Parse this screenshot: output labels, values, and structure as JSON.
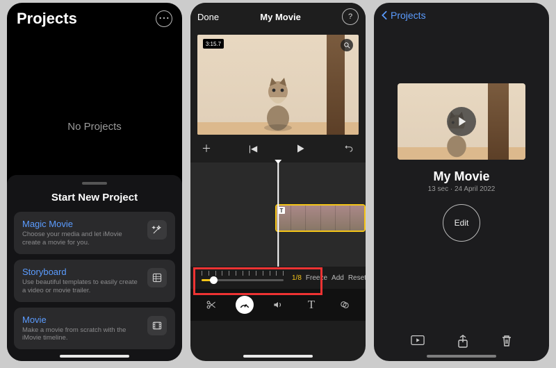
{
  "left": {
    "title": "Projects",
    "no_projects": "No Projects",
    "sheet_title": "Start New Project",
    "options": [
      {
        "title": "Magic Movie",
        "subtitle": "Choose your media and let iMovie create a movie for you.",
        "icon": "magic-wand"
      },
      {
        "title": "Storyboard",
        "subtitle": "Use beautiful templates to easily create a video or movie trailer.",
        "icon": "storyboard"
      },
      {
        "title": "Movie",
        "subtitle": "Make a movie from scratch with the iMovie timeline.",
        "icon": "film"
      }
    ]
  },
  "mid": {
    "done": "Done",
    "title": "My Movie",
    "clip_duration": "3:15.7",
    "speed_value": "1/8",
    "actions": {
      "freeze": "Freeze",
      "add": "Add",
      "reset": "Reset"
    }
  },
  "right": {
    "back": "Projects",
    "title": "My Movie",
    "subtitle": "13 sec · 24 April 2022",
    "edit": "Edit"
  }
}
